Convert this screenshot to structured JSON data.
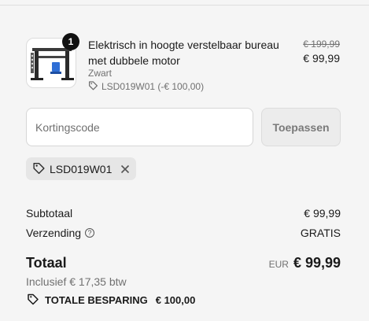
{
  "product": {
    "quantity": "1",
    "title": "Elektrisch in hoogte verstelbaar bureau met dubbele motor",
    "variant": "Zwart",
    "discount_label": "LSD019W01 (-€ 100,00)",
    "original_price": "€ 199,99",
    "price": "€ 99,99"
  },
  "discount_form": {
    "placeholder": "Kortingscode",
    "value": "",
    "apply_label": "Toepassen"
  },
  "applied_code": {
    "code": "LSD019W01"
  },
  "summary": {
    "subtotal_label": "Subtotaal",
    "subtotal_value": "€ 99,99",
    "shipping_label": "Verzending",
    "shipping_value": "GRATIS",
    "total_label": "Totaal",
    "currency": "EUR",
    "total_value": "€ 99,99",
    "tax_note": "Inclusief € 17,35 btw",
    "savings_label": "TOTALE BESPARING",
    "savings_value": "€ 100,00"
  },
  "icons": {
    "tag": "tag-icon",
    "close": "close-icon",
    "help": "question-circle-icon"
  }
}
